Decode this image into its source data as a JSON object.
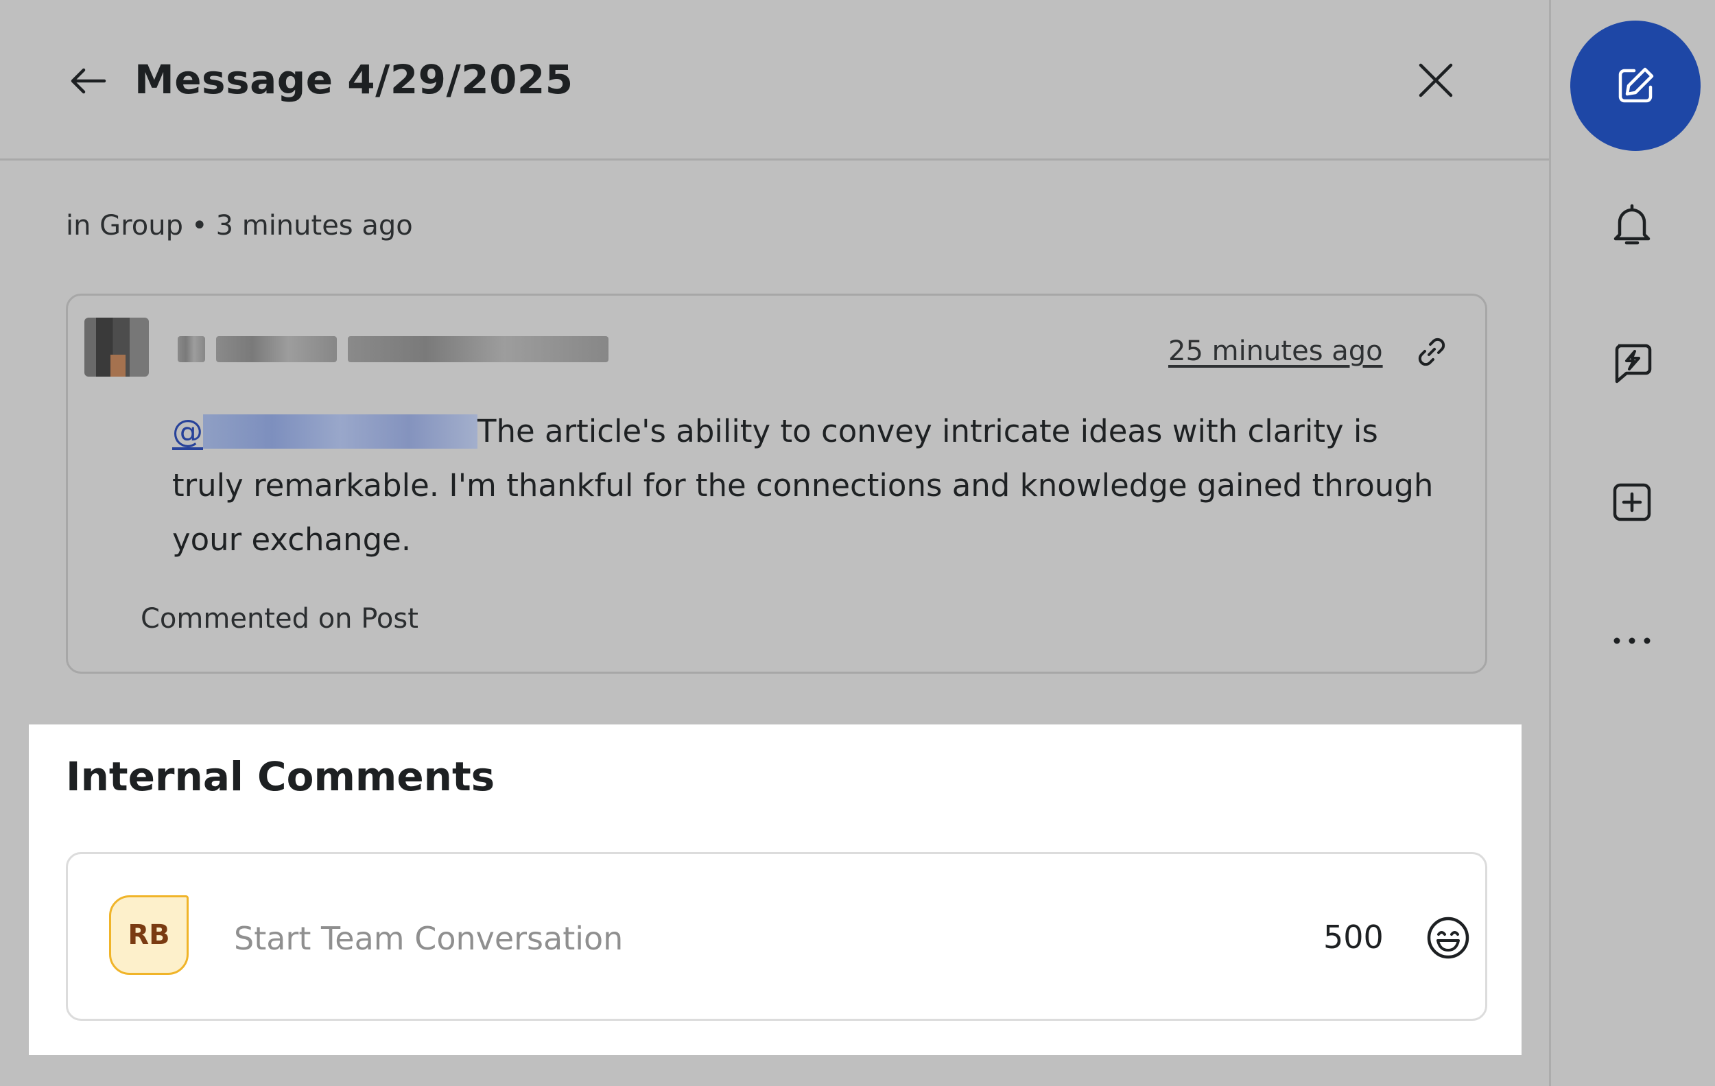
{
  "header": {
    "title": "Message 4/29/2025"
  },
  "meta": {
    "location": "in Group",
    "separator": "•",
    "time": "3 minutes ago"
  },
  "message": {
    "timestamp": "25 minutes ago",
    "mention_prefix": "@",
    "body": "The article's ability to convey intricate ideas with clarity is truly remarkable. I'm thankful for the connections and knowledge gained through your exchange.",
    "context": "Commented on Post"
  },
  "internal_comments": {
    "title": "Internal Comments",
    "avatar_initials": "RB",
    "placeholder": "Start Team Conversation",
    "char_limit": "500"
  },
  "colors": {
    "accent": "#1e47a6",
    "mention": "#27429a",
    "avatar_bg": "#fdf0cb",
    "avatar_border": "#f0b429"
  },
  "icons": {
    "back": "arrow-left-icon",
    "close": "close-icon",
    "link": "link-icon",
    "emoji": "emoji-icon",
    "compose": "edit-icon",
    "notifications": "bell-icon",
    "quick_reply": "lightning-chat-icon",
    "add": "plus-square-icon",
    "more": "more-horizontal-icon"
  }
}
